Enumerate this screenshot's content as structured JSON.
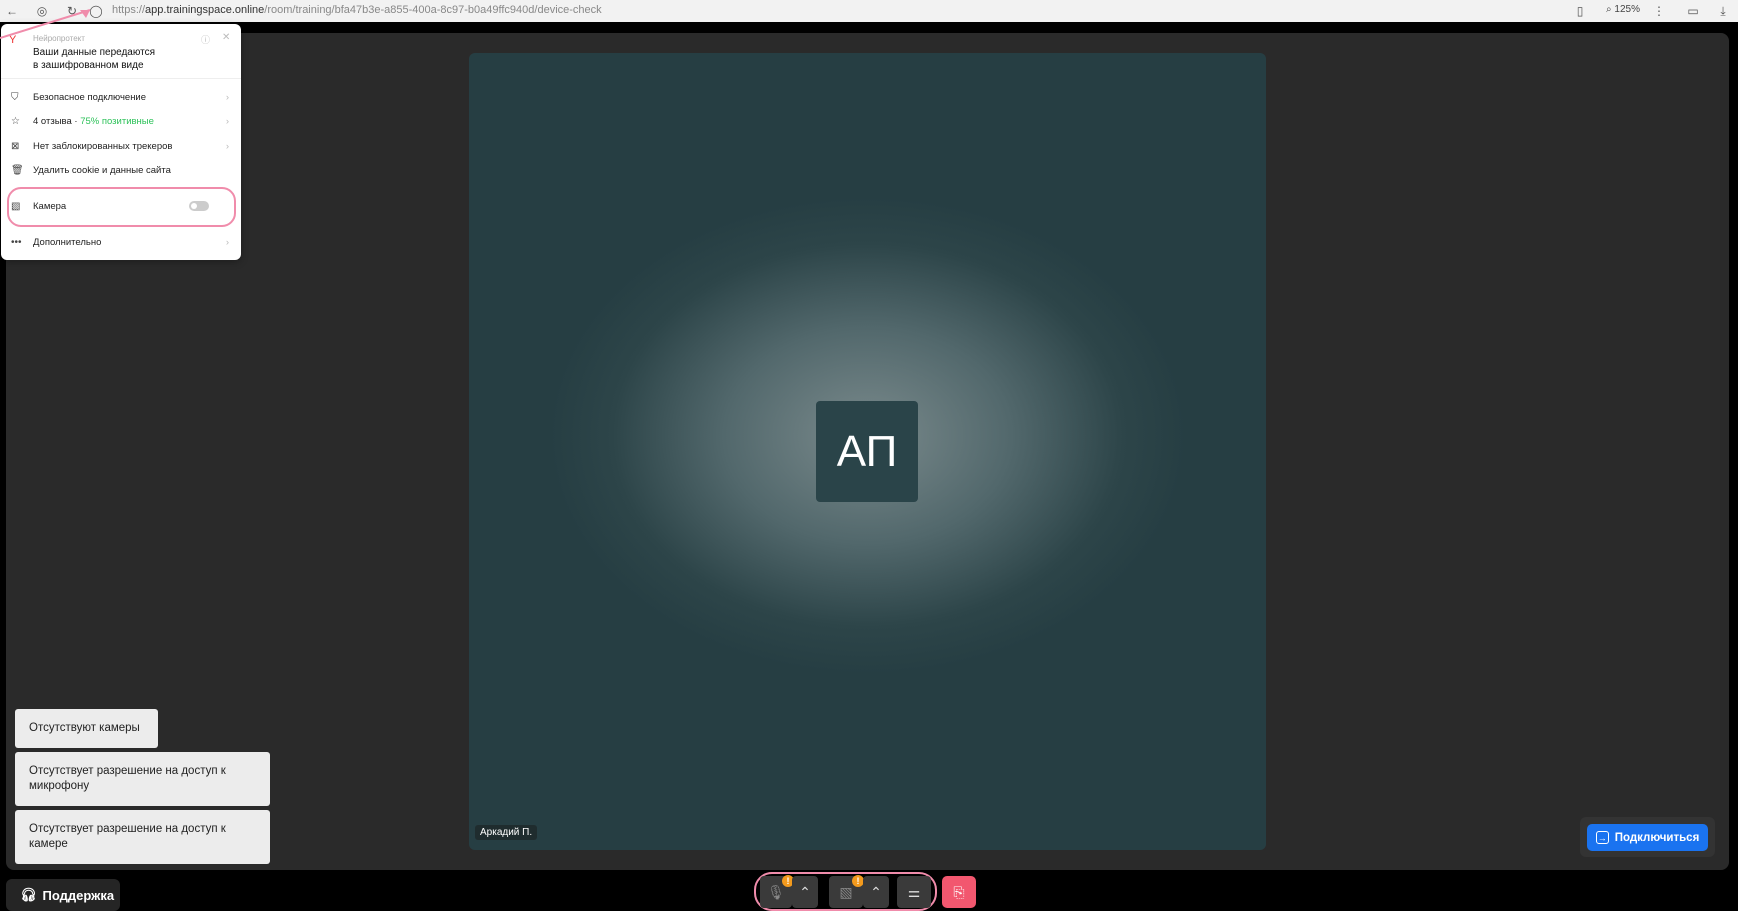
{
  "browser": {
    "url_host": "app.trainingspace.online",
    "url_path": "/room/training/bfa47b3e-a855-400a-8c97-b0a49ffc940d/device-check",
    "url_scheme": "https://",
    "zoom": "125%"
  },
  "popup": {
    "brand": "Нейропротект",
    "title_line1": "Ваши данные передаются",
    "title_line2": "в зашифрованном виде",
    "items": [
      {
        "label": "Безопасное подключение"
      },
      {
        "label": "4 отзыва · ",
        "extra": "75% позитивные"
      },
      {
        "label": "Нет заблокированных трекеров"
      },
      {
        "label": "Удалить cookie и данные сайта"
      },
      {
        "label": "Камера"
      },
      {
        "label": "Дополнительно"
      }
    ],
    "camera_enabled": false,
    "positive_color": "#2ec25a"
  },
  "video": {
    "initials": "АП",
    "name": "Аркадий П."
  },
  "messages": [
    "Отсутствуют камеры",
    "Отсутствует разрешение на доступ к микрофону",
    "Отсутствует разрешение на доступ к камере"
  ],
  "support_label": "Поддержка",
  "connect_label": "Подключиться",
  "badges": {
    "mic": "!",
    "cam": "!"
  },
  "colors": {
    "accent": "#1a73f0",
    "leave": "#f2576f",
    "highlight": "#f08cab",
    "warning": "#f39a1d"
  }
}
